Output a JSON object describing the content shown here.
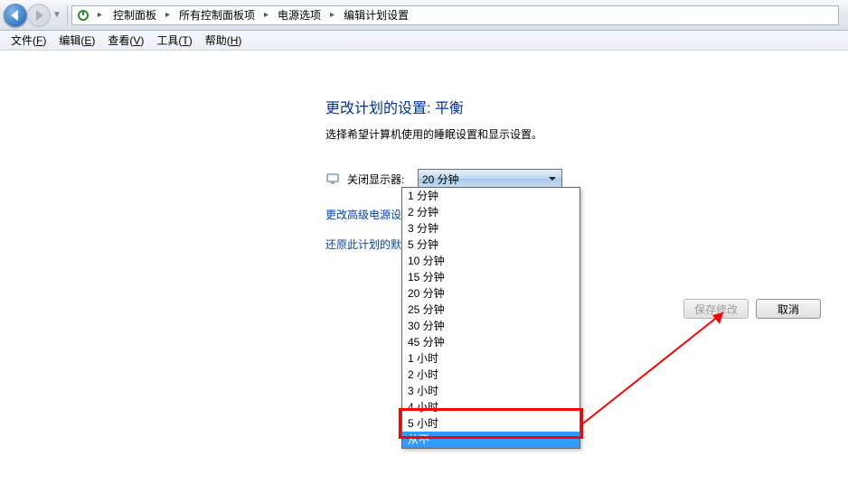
{
  "nav": {
    "breadcrumb": [
      "控制面板",
      "所有控制面板项",
      "电源选项",
      "编辑计划设置"
    ]
  },
  "menu": {
    "file": "文件(",
    "file_u": "F",
    "edit": "编辑(",
    "edit_u": "E",
    "view": "查看(",
    "view_u": "V",
    "tools": "工具(",
    "tools_u": "T",
    "help": "帮助(",
    "help_u": "H",
    "close": ")"
  },
  "page": {
    "heading": "更改计划的设置: 平衡",
    "subtext": "选择希望计算机使用的睡眠设置和显示设置。",
    "turn_off_display_label": "关闭显示器:",
    "turn_off_display_value": "20 分钟",
    "link_advanced": "更改高级电源设置(C",
    "link_restore": "还原此计划的默认设"
  },
  "dropdown_options": [
    "1 分钟",
    "2 分钟",
    "3 分钟",
    "5 分钟",
    "10 分钟",
    "15 分钟",
    "20 分钟",
    "25 分钟",
    "30 分钟",
    "45 分钟",
    "1 小时",
    "2 小时",
    "3 小时",
    "4 小时",
    "5 小时",
    "从不"
  ],
  "dropdown_selected": "从不",
  "buttons": {
    "save": "保存修改",
    "cancel": "取消"
  }
}
